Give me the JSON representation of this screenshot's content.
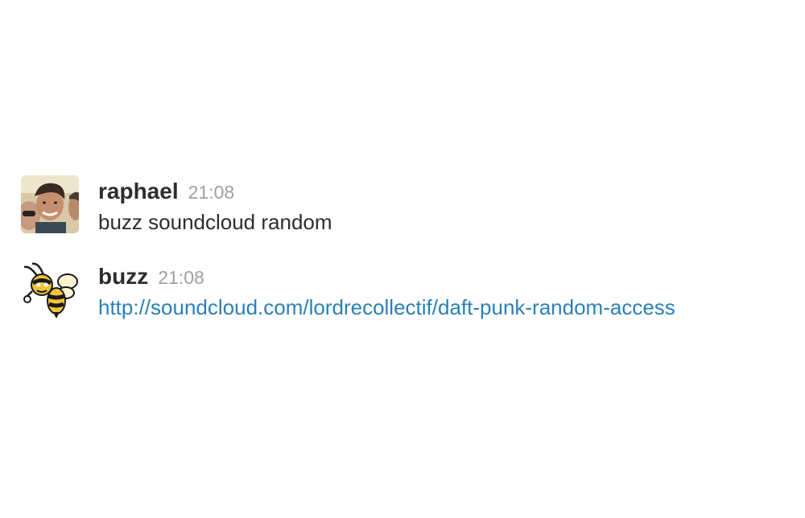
{
  "messages": [
    {
      "user": "raphael",
      "time": "21:08",
      "text": "buzz soundcloud random",
      "avatar": "photo-avatar"
    },
    {
      "user": "buzz",
      "time": "21:08",
      "link": "http://soundcloud.com/lordrecollectif/daft-punk-random-access",
      "avatar": "bee-mascot-icon"
    }
  ],
  "colors": {
    "username": "#2c2d30",
    "timestamp": "#a0a0a2",
    "link": "#2a80b9"
  }
}
